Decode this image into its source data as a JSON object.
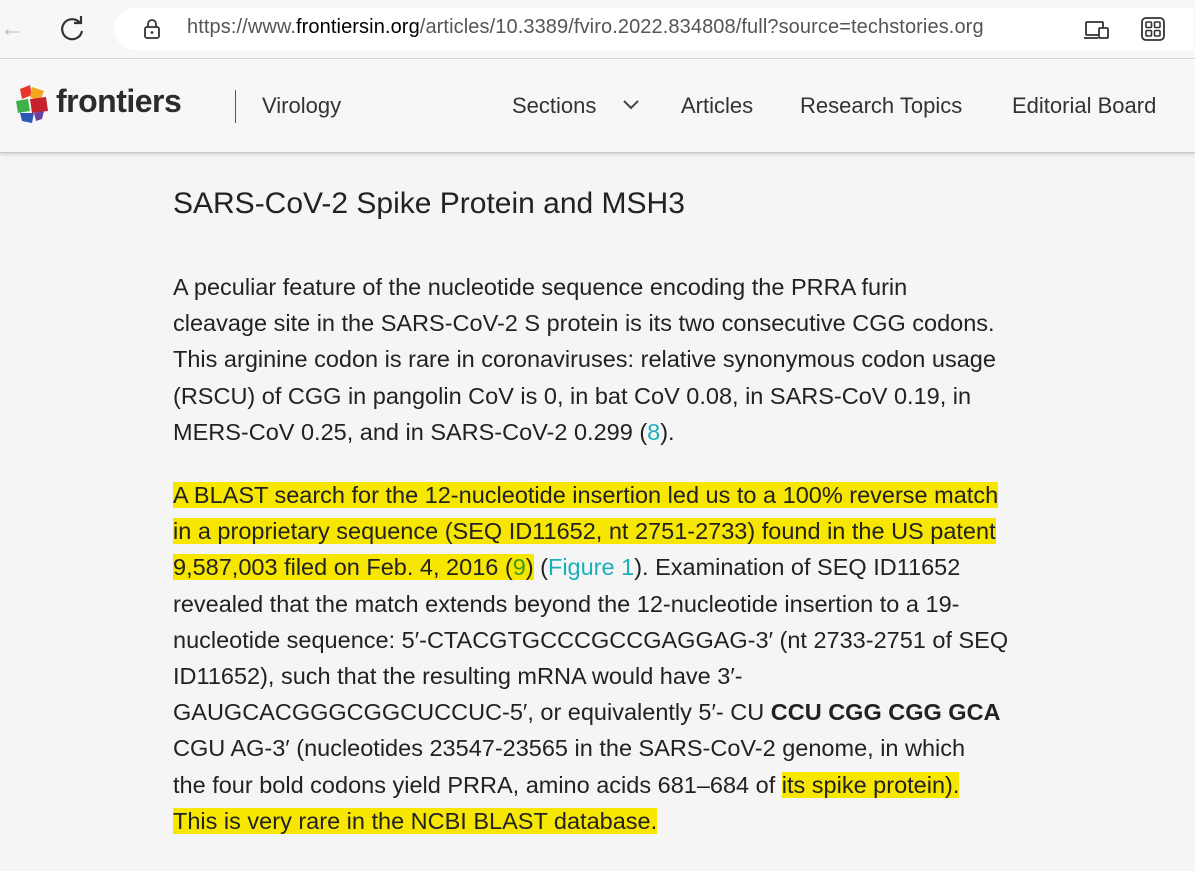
{
  "browser": {
    "url_prefix": "https://www.",
    "url_domain": "frontiersin.org",
    "url_path": "/articles/10.3389/fviro.2022.834808/full?source=techstories.org",
    "back_glyph": "←"
  },
  "header": {
    "logo_text": "frontiers",
    "journal": "Virology",
    "nav": {
      "sections": "Sections",
      "articles": "Articles",
      "research_topics": "Research Topics",
      "editorial_board": "Editorial Board"
    }
  },
  "article": {
    "title": "SARS-CoV-2 Spike Protein and MSH3",
    "p1": {
      "l1": "A peculiar feature of the nucleotide sequence encoding the PRRA furin",
      "l2": "cleavage site in the SARS-CoV-2 S protein is its two consecutive CGG codons.",
      "l3": "This arginine codon is rare in coronaviruses: relative synonymous codon usage",
      "l4": "(RSCU) of CGG in pangolin CoV is 0, in bat CoV 0.08, in SARS-CoV 0.19, in",
      "l5_a": "MERS-CoV 0.25, and in SARS-CoV-2 0.299 (",
      "l5_ref": "8",
      "l5_b": ")."
    },
    "p2": {
      "l1": "A BLAST search for the 12-nucleotide insertion led us to a 100% reverse match",
      "l2": "in a proprietary sequence (SEQ ID11652, nt 2751-2733) found in the US patent",
      "l3_a": "9,587,003 filed on Feb. 4, 2016 (",
      "l3_ref": "9",
      "l3_b": ")",
      "l3_c": " (",
      "l3_fig": "Figure 1",
      "l3_d": "). Examination of SEQ ID11652",
      "l4": "revealed that the match extends beyond the 12-nucleotide insertion to a 19-",
      "l5": "nucleotide sequence: 5′-CTACGTGCCCGCCGAGGAG-3′ (nt 2733-2751 of SEQ",
      "l6": "ID11652), such that the resulting mRNA would have 3′-",
      "l7_a": "GAUGCACGGGCGGCUCCUC-5′, or equivalently 5′- CU ",
      "l7_bold": "CCU CGG CGG GCA",
      "l8": "CGU AG-3′ (nucleotides 23547-23565 in the SARS-CoV-2 genome, in which",
      "l9_a": "the four bold codons yield PRRA, amino acids 681–684 of ",
      "l9_hl": "its spike protein).",
      "l10": "This is very rare in the NCBI BLAST database."
    }
  },
  "colors": {
    "highlight": "#f7e600",
    "link": "#1ab0ba",
    "ref_green": "#3d9a1b"
  }
}
